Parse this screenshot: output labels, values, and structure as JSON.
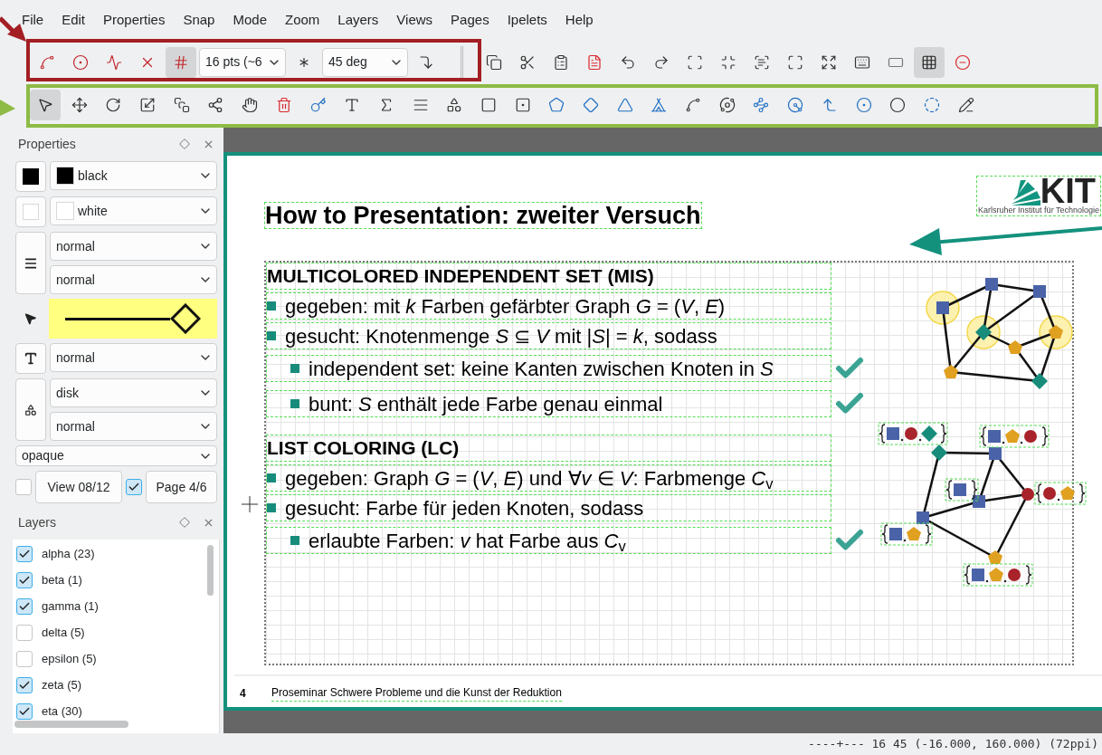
{
  "menu": [
    "File",
    "Edit",
    "Properties",
    "Snap",
    "Mode",
    "Zoom",
    "Layers",
    "Views",
    "Pages",
    "Ipelets",
    "Help"
  ],
  "snap_buttons": [
    {
      "selected": false
    },
    {
      "selected": false
    },
    {
      "selected": false
    },
    {
      "selected": false
    },
    {
      "selected": true
    },
    {
      "selected": false
    },
    {
      "selected": false
    }
  ],
  "grid_size": "16 pts (~6",
  "snap_angle": "45 deg",
  "edit_buttons": [
    {
      "selected": false
    },
    {
      "selected": false
    },
    {
      "selected": false
    },
    {
      "selected": false
    },
    {
      "selected": false
    },
    {
      "selected": false
    },
    {
      "selected": false
    },
    {
      "selected": false
    },
    {
      "selected": false
    },
    {
      "selected": false
    },
    {
      "selected": false
    },
    {
      "selected": false
    },
    {
      "selected": false
    },
    {
      "selected": true
    },
    {
      "selected": false
    }
  ],
  "mode_tools": [
    {
      "selected": true
    },
    {
      "selected": false
    },
    {
      "selected": false
    },
    {
      "selected": false
    },
    {
      "selected": false
    },
    {
      "selected": false
    },
    {
      "selected": false
    },
    {
      "selected": false
    },
    {
      "selected": false
    },
    {
      "selected": false
    },
    {
      "selected": false
    },
    {
      "selected": false
    },
    {
      "selected": false
    },
    {
      "selected": false
    },
    {
      "selected": false
    },
    {
      "selected": false
    },
    {
      "selected": false
    },
    {
      "selected": false
    },
    {
      "selected": false
    },
    {
      "selected": false
    },
    {
      "selected": false
    },
    {
      "selected": false
    },
    {
      "selected": false
    },
    {
      "selected": false
    },
    {
      "selected": false
    },
    {
      "selected": false
    },
    {
      "selected": false
    },
    {
      "selected": false
    }
  ],
  "properties": {
    "title": "Properties",
    "stroke": {
      "color": "#000000",
      "value": "black"
    },
    "fill": {
      "color": "#ffffff",
      "value": "white"
    },
    "pen": "normal",
    "dash": "normal",
    "text_size": "normal",
    "mark_shape": "disk",
    "mark_size": "normal",
    "opacity": "opaque",
    "view": {
      "checked": false,
      "label": "View 08/12"
    },
    "page": {
      "checked": true,
      "label": "Page 4/6"
    }
  },
  "layers": {
    "title": "Layers",
    "items": [
      {
        "name": "alpha (23)",
        "checked": true
      },
      {
        "name": "beta (1)",
        "checked": true
      },
      {
        "name": "gamma (1)",
        "checked": true
      },
      {
        "name": "delta (5)",
        "checked": false
      },
      {
        "name": "epsilon (5)",
        "checked": false
      },
      {
        "name": "zeta (5)",
        "checked": true
      },
      {
        "name": "eta (30)",
        "checked": true
      }
    ]
  },
  "slide": {
    "title": "How to Presentation: zweiter Versuch",
    "logo": {
      "text": "KIT",
      "tagline": "Karlsruher Institut für Technologie"
    },
    "lines": [
      {
        "kind": "heading",
        "text": "MULTICOLORED INDEPENDENT SET (MIS)",
        "checked": false
      },
      {
        "kind": "bullet",
        "text": "gegeben: mit *k* Farben gefärbter Graph *G* = (*V*, *E*)",
        "checked": false
      },
      {
        "kind": "bullet",
        "text": "gesucht: Knotenmenge *S* ⊆ *V* mit |*S*| = *k*, sodass",
        "checked": false
      },
      {
        "kind": "subbullet",
        "text": "independent set: keine Kanten zwischen Knoten in *S*",
        "checked": true
      },
      {
        "kind": "subbullet",
        "text": "bunt: *S* enthält jede Farbe genau einmal",
        "checked": true
      },
      {
        "kind": "heading",
        "text": "LIST COLORING (LC)",
        "checked": false
      },
      {
        "kind": "bullet",
        "text": "gegeben: Graph *G* = (*V*, *E*) und ∀*v* ∈ *V*: Farbmenge *C*$_{v}$",
        "checked": false
      },
      {
        "kind": "bullet",
        "text": "gesucht: Farbe für jeden Knoten, sodass",
        "checked": false
      },
      {
        "kind": "subbullet",
        "text": "erlaubte Farben: *v* hat Farbe aus *C*$_{v}$",
        "checked": true
      }
    ],
    "page_number": "4",
    "footer": "Proseminar Schwere Probleme und die Kunst der Reduktion"
  },
  "status": "----+--- 16 45 (-16.000, 160.000) (72ppi)"
}
